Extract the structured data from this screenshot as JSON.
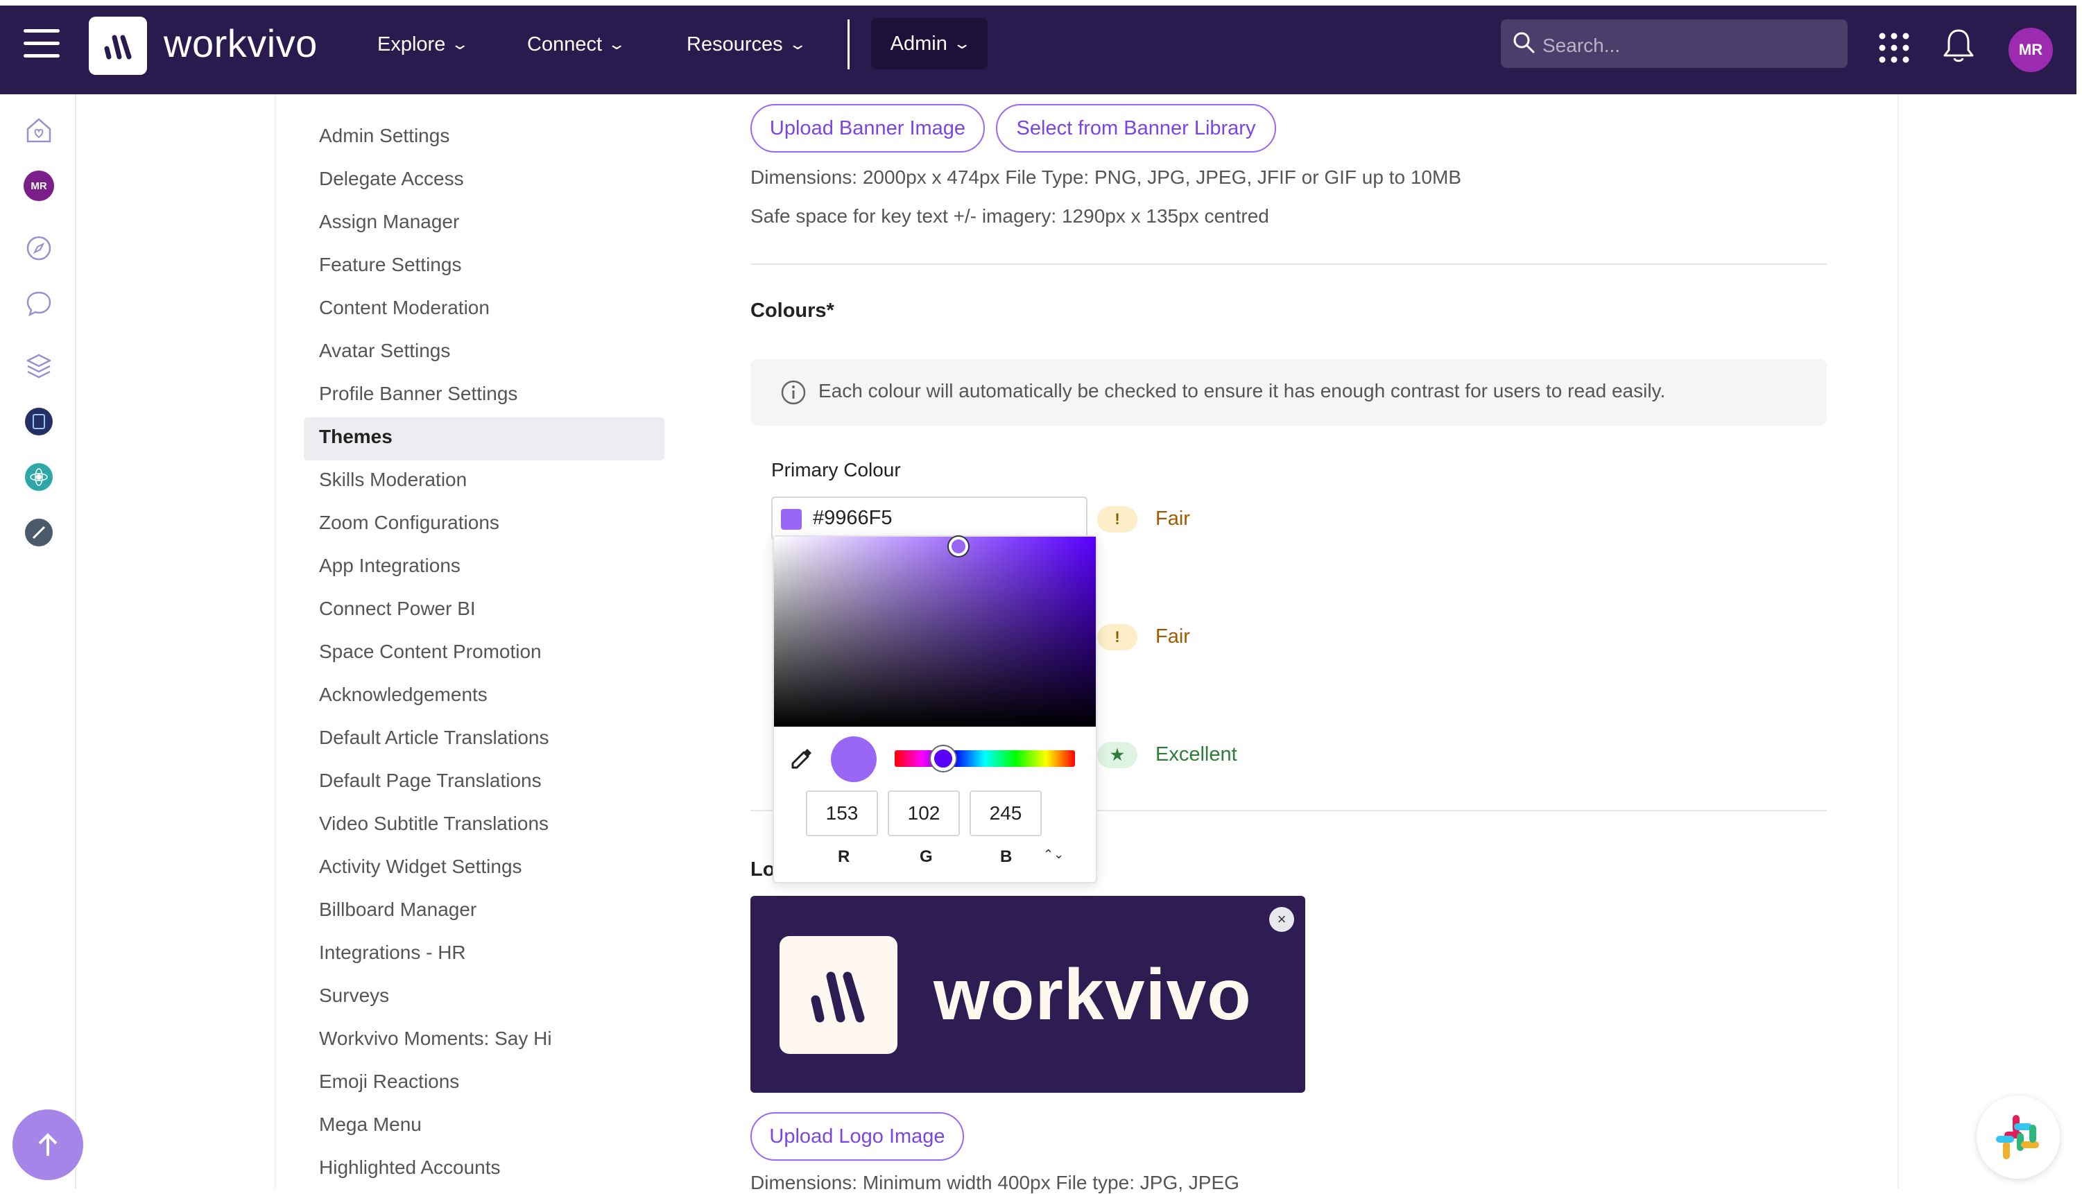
{
  "topbar": {
    "brand": "workvivo",
    "nav": [
      {
        "label": "Explore"
      },
      {
        "label": "Connect"
      },
      {
        "label": "Resources"
      }
    ],
    "admin_label": "Admin",
    "search_placeholder": "Search...",
    "avatar_initials": "MR",
    "background_color": "#2a1b4e"
  },
  "rail": {
    "avatar_initials": "MR"
  },
  "menu": {
    "items": [
      "Admin Settings",
      "Delegate Access",
      "Assign Manager",
      "Feature Settings",
      "Content Moderation",
      "Avatar Settings",
      "Profile Banner Settings",
      "Themes",
      "Skills Moderation",
      "Zoom Configurations",
      "App Integrations",
      "Connect Power BI",
      "Space Content Promotion",
      "Acknowledgements",
      "Default Article Translations",
      "Default Page Translations",
      "Video Subtitle Translations",
      "Activity Widget Settings",
      "Billboard Manager",
      "Integrations - HR",
      "Surveys",
      "Workvivo Moments: Say Hi",
      "Emoji Reactions",
      "Mega Menu",
      "Highlighted Accounts"
    ],
    "active": "Themes"
  },
  "banner": {
    "upload_label": "Upload Banner Image",
    "library_label": "Select from Banner Library",
    "dimensions": "Dimensions: 2000px x 474px  File Type: PNG, JPG, JPEG, JFIF or GIF up to 10MB",
    "safe_space": "Safe space for key text +/- imagery: 1290px x 135px centred"
  },
  "colours": {
    "title": "Colours*",
    "info": "Each colour will automatically be checked to ensure it has enough contrast for users to read easily.",
    "primary_label": "Primary Colour",
    "primary_hex": "#9966F5",
    "ratings": [
      {
        "badge": "!",
        "label": "Fair"
      },
      {
        "badge": "!",
        "label": "Fair"
      },
      {
        "badge": "★",
        "label": "Excellent"
      }
    ]
  },
  "picker": {
    "r": "153",
    "g": "102",
    "b": "245",
    "r_label": "R",
    "g_label": "G",
    "b_label": "B",
    "toggle": "⌃⌄"
  },
  "logo": {
    "label_partial": "Lo",
    "preview_text": "workvivo",
    "close": "×",
    "upload_label": "Upload Logo Image",
    "dimensions": "Dimensions: Minimum width 400px  File type: JPG, JPEG"
  },
  "colors": {
    "accent": "#9966F5",
    "brand_dark": "#2a1b4e",
    "fair": "#a05a00",
    "excellent": "#2e7d3a"
  }
}
